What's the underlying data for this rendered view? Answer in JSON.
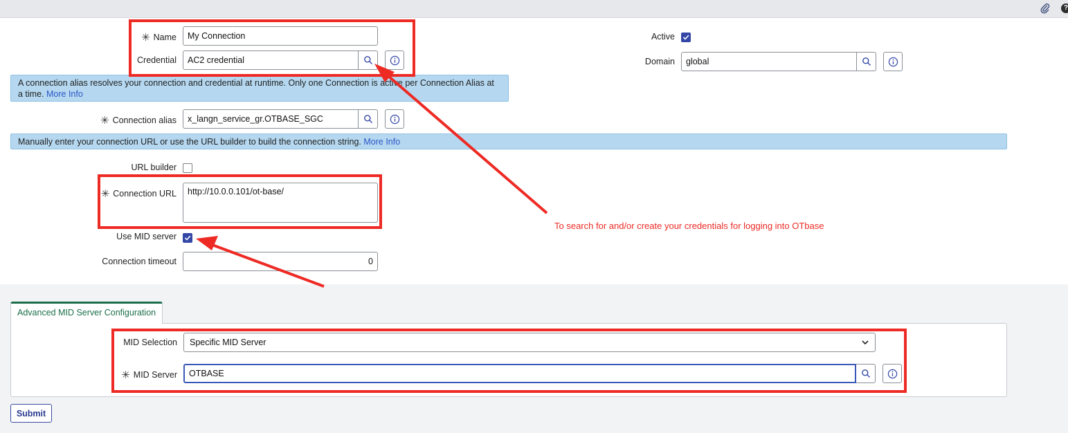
{
  "form": {
    "name": {
      "label": "Name",
      "value": "My Connection"
    },
    "credential": {
      "label": "Credential",
      "value": "AC2 credential"
    },
    "active": {
      "label": "Active",
      "checked": true
    },
    "domain": {
      "label": "Domain",
      "value": "global"
    },
    "alias_banner": {
      "text": "A connection alias resolves your connection and credential at runtime. Only one Connection is active per Connection Alias at a time.",
      "link": "More Info"
    },
    "connection_alias": {
      "label": "Connection alias",
      "value": "x_langn_service_gr.OTBASE_SGC"
    },
    "url_banner": {
      "text": "Manually enter your connection URL or use the URL builder to build the connection string.",
      "link": "More Info"
    },
    "url_builder": {
      "label": "URL builder",
      "checked": false
    },
    "connection_url": {
      "label": "Connection URL",
      "value": "http://10.0.0.101/ot-base/"
    },
    "use_mid_server": {
      "label": "Use MID server",
      "checked": true
    },
    "connection_timeout": {
      "label": "Connection timeout",
      "value": "0"
    }
  },
  "advanced": {
    "tab_label": "Advanced MID Server Configuration",
    "mid_selection": {
      "label": "MID Selection",
      "value": "Specific MID Server"
    },
    "mid_server": {
      "label": "MID Server",
      "value": "OTBASE"
    }
  },
  "submit_label": "Submit",
  "annotation": "To search for and/or create your credentials for logging into OTbase",
  "icons": {
    "search": "search-icon",
    "info": "info-icon",
    "required": "asterisk-icon",
    "attachment": "paperclip-icon",
    "help": "help-icon"
  },
  "colors": {
    "accent": "#3447a6",
    "banner": "#b5d8f0",
    "highlight": "#ee2a24",
    "tab": "#1b6e4a"
  }
}
